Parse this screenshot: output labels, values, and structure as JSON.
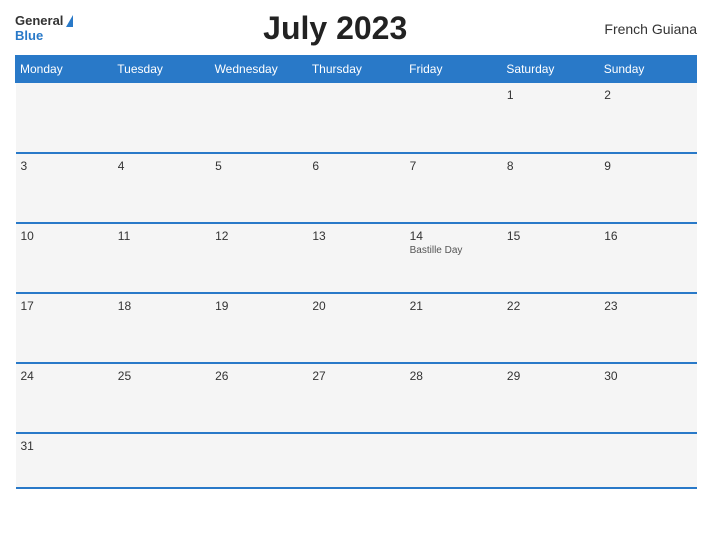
{
  "header": {
    "logo_general": "General",
    "logo_blue": "Blue",
    "title": "July 2023",
    "region": "French Guiana"
  },
  "weekdays": [
    "Monday",
    "Tuesday",
    "Wednesday",
    "Thursday",
    "Friday",
    "Saturday",
    "Sunday"
  ],
  "weeks": [
    [
      {
        "day": "",
        "event": ""
      },
      {
        "day": "",
        "event": ""
      },
      {
        "day": "",
        "event": ""
      },
      {
        "day": "",
        "event": ""
      },
      {
        "day": "",
        "event": ""
      },
      {
        "day": "1",
        "event": ""
      },
      {
        "day": "2",
        "event": ""
      }
    ],
    [
      {
        "day": "3",
        "event": ""
      },
      {
        "day": "4",
        "event": ""
      },
      {
        "day": "5",
        "event": ""
      },
      {
        "day": "6",
        "event": ""
      },
      {
        "day": "7",
        "event": ""
      },
      {
        "day": "8",
        "event": ""
      },
      {
        "day": "9",
        "event": ""
      }
    ],
    [
      {
        "day": "10",
        "event": ""
      },
      {
        "day": "11",
        "event": ""
      },
      {
        "day": "12",
        "event": ""
      },
      {
        "day": "13",
        "event": ""
      },
      {
        "day": "14",
        "event": "Bastille Day"
      },
      {
        "day": "15",
        "event": ""
      },
      {
        "day": "16",
        "event": ""
      }
    ],
    [
      {
        "day": "17",
        "event": ""
      },
      {
        "day": "18",
        "event": ""
      },
      {
        "day": "19",
        "event": ""
      },
      {
        "day": "20",
        "event": ""
      },
      {
        "day": "21",
        "event": ""
      },
      {
        "day": "22",
        "event": ""
      },
      {
        "day": "23",
        "event": ""
      }
    ],
    [
      {
        "day": "24",
        "event": ""
      },
      {
        "day": "25",
        "event": ""
      },
      {
        "day": "26",
        "event": ""
      },
      {
        "day": "27",
        "event": ""
      },
      {
        "day": "28",
        "event": ""
      },
      {
        "day": "29",
        "event": ""
      },
      {
        "day": "30",
        "event": ""
      }
    ],
    [
      {
        "day": "31",
        "event": ""
      },
      {
        "day": "",
        "event": ""
      },
      {
        "day": "",
        "event": ""
      },
      {
        "day": "",
        "event": ""
      },
      {
        "day": "",
        "event": ""
      },
      {
        "day": "",
        "event": ""
      },
      {
        "day": "",
        "event": ""
      }
    ]
  ]
}
